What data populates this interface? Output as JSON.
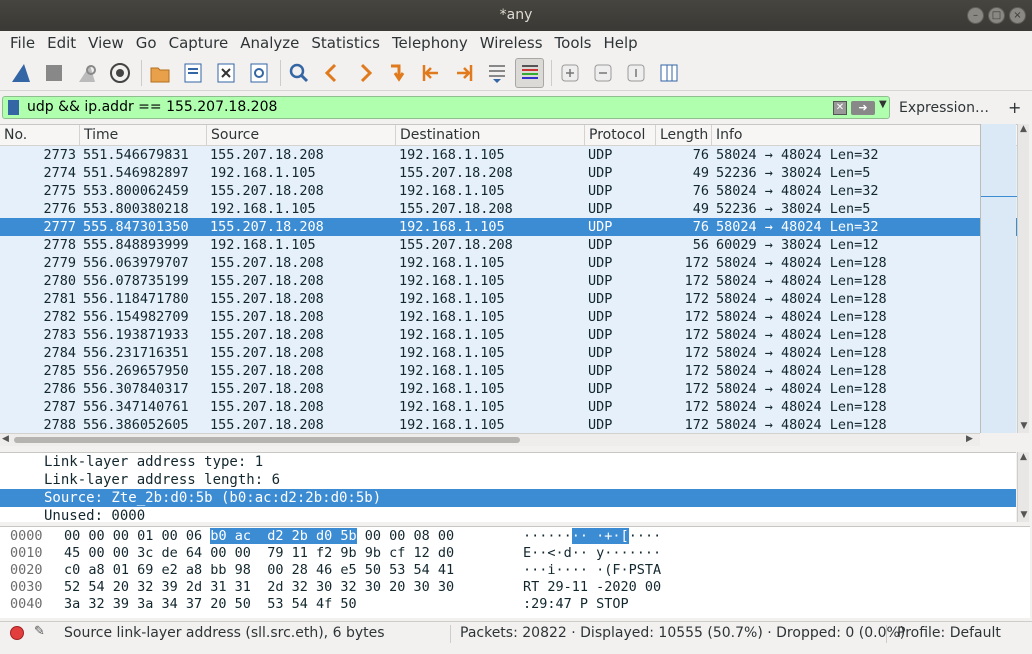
{
  "window": {
    "title": "*any"
  },
  "menu": [
    "File",
    "Edit",
    "View",
    "Go",
    "Capture",
    "Analyze",
    "Statistics",
    "Telephony",
    "Wireless",
    "Tools",
    "Help"
  ],
  "filter": {
    "value": "udp  && ip.addr == 155.207.18.208",
    "expression_label": "Expression…",
    "plus_label": "+"
  },
  "columns": [
    "No.",
    "Time",
    "Source",
    "Destination",
    "Protocol",
    "Length",
    "Info"
  ],
  "packets": [
    {
      "no": "2773",
      "time": "551.546679831",
      "src": "155.207.18.208",
      "dst": "192.168.1.105",
      "proto": "UDP",
      "len": "76",
      "info": "58024 → 48024 Len=32"
    },
    {
      "no": "2774",
      "time": "551.546982897",
      "src": "192.168.1.105",
      "dst": "155.207.18.208",
      "proto": "UDP",
      "len": "49",
      "info": "52236 → 38024 Len=5"
    },
    {
      "no": "2775",
      "time": "553.800062459",
      "src": "155.207.18.208",
      "dst": "192.168.1.105",
      "proto": "UDP",
      "len": "76",
      "info": "58024 → 48024 Len=32"
    },
    {
      "no": "2776",
      "time": "553.800380218",
      "src": "192.168.1.105",
      "dst": "155.207.18.208",
      "proto": "UDP",
      "len": "49",
      "info": "52236 → 38024 Len=5"
    },
    {
      "no": "2777",
      "time": "555.847301350",
      "src": "155.207.18.208",
      "dst": "192.168.1.105",
      "proto": "UDP",
      "len": "76",
      "info": "58024 → 48024 Len=32",
      "selected": true
    },
    {
      "no": "2778",
      "time": "555.848893999",
      "src": "192.168.1.105",
      "dst": "155.207.18.208",
      "proto": "UDP",
      "len": "56",
      "info": "60029 → 38024 Len=12"
    },
    {
      "no": "2779",
      "time": "556.063979707",
      "src": "155.207.18.208",
      "dst": "192.168.1.105",
      "proto": "UDP",
      "len": "172",
      "info": "58024 → 48024 Len=128"
    },
    {
      "no": "2780",
      "time": "556.078735199",
      "src": "155.207.18.208",
      "dst": "192.168.1.105",
      "proto": "UDP",
      "len": "172",
      "info": "58024 → 48024 Len=128"
    },
    {
      "no": "2781",
      "time": "556.118471780",
      "src": "155.207.18.208",
      "dst": "192.168.1.105",
      "proto": "UDP",
      "len": "172",
      "info": "58024 → 48024 Len=128"
    },
    {
      "no": "2782",
      "time": "556.154982709",
      "src": "155.207.18.208",
      "dst": "192.168.1.105",
      "proto": "UDP",
      "len": "172",
      "info": "58024 → 48024 Len=128"
    },
    {
      "no": "2783",
      "time": "556.193871933",
      "src": "155.207.18.208",
      "dst": "192.168.1.105",
      "proto": "UDP",
      "len": "172",
      "info": "58024 → 48024 Len=128"
    },
    {
      "no": "2784",
      "time": "556.231716351",
      "src": "155.207.18.208",
      "dst": "192.168.1.105",
      "proto": "UDP",
      "len": "172",
      "info": "58024 → 48024 Len=128"
    },
    {
      "no": "2785",
      "time": "556.269657950",
      "src": "155.207.18.208",
      "dst": "192.168.1.105",
      "proto": "UDP",
      "len": "172",
      "info": "58024 → 48024 Len=128"
    },
    {
      "no": "2786",
      "time": "556.307840317",
      "src": "155.207.18.208",
      "dst": "192.168.1.105",
      "proto": "UDP",
      "len": "172",
      "info": "58024 → 48024 Len=128"
    },
    {
      "no": "2787",
      "time": "556.347140761",
      "src": "155.207.18.208",
      "dst": "192.168.1.105",
      "proto": "UDP",
      "len": "172",
      "info": "58024 → 48024 Len=128"
    },
    {
      "no": "2788",
      "time": "556.386052605",
      "src": "155.207.18.208",
      "dst": "192.168.1.105",
      "proto": "UDP",
      "len": "172",
      "info": "58024 → 48024 Len=128"
    }
  ],
  "details": [
    {
      "text": "Link-layer address type: 1"
    },
    {
      "text": "Link-layer address length: 6"
    },
    {
      "text": "Source: Zte_2b:d0:5b (b0:ac:d2:2b:d0:5b)",
      "selected": true
    },
    {
      "text": "Unused: 0000"
    }
  ],
  "bytes": [
    {
      "offset": "0000",
      "hex_pre": "00 00 00 01 00 06 ",
      "hex_hl": "b0 ac  d2 2b d0 5b",
      "hex_post": " 00 00 08 00",
      "ascii_pre": "······",
      "ascii_hl": "·· ·+·[",
      "ascii_post": "····"
    },
    {
      "offset": "0010",
      "hex_pre": "45 00 00 3c de 64 00 00  79 11 f2 9b 9b cf 12 d0",
      "hex_hl": "",
      "hex_post": "",
      "ascii_pre": "E··<·d·· y·······",
      "ascii_hl": "",
      "ascii_post": ""
    },
    {
      "offset": "0020",
      "hex_pre": "c0 a8 01 69 e2 a8 bb 98  00 28 46 e5 50 53 54 41",
      "hex_hl": "",
      "hex_post": "",
      "ascii_pre": "···i···· ·(F·PSTA",
      "ascii_hl": "",
      "ascii_post": ""
    },
    {
      "offset": "0030",
      "hex_pre": "52 54 20 32 39 2d 31 31  2d 32 30 32 30 20 30 30",
      "hex_hl": "",
      "hex_post": "",
      "ascii_pre": "RT 29-11 -2020 00",
      "ascii_hl": "",
      "ascii_post": ""
    },
    {
      "offset": "0040",
      "hex_pre": "3a 32 39 3a 34 37 20 50  53 54 4f 50",
      "hex_hl": "",
      "hex_post": "",
      "ascii_pre": ":29:47 P STOP",
      "ascii_hl": "",
      "ascii_post": ""
    }
  ],
  "status": {
    "field_text": "Source link-layer address (sll.src.eth), 6 bytes",
    "counts": "Packets: 20822 · Displayed: 10555 (50.7%) · Dropped: 0 (0.0%)",
    "profile": "Profile: Default"
  },
  "colors": {
    "selection": "#3c8cd3",
    "row_bg": "#e6f0fb",
    "filter_ok": "#afffaf"
  }
}
